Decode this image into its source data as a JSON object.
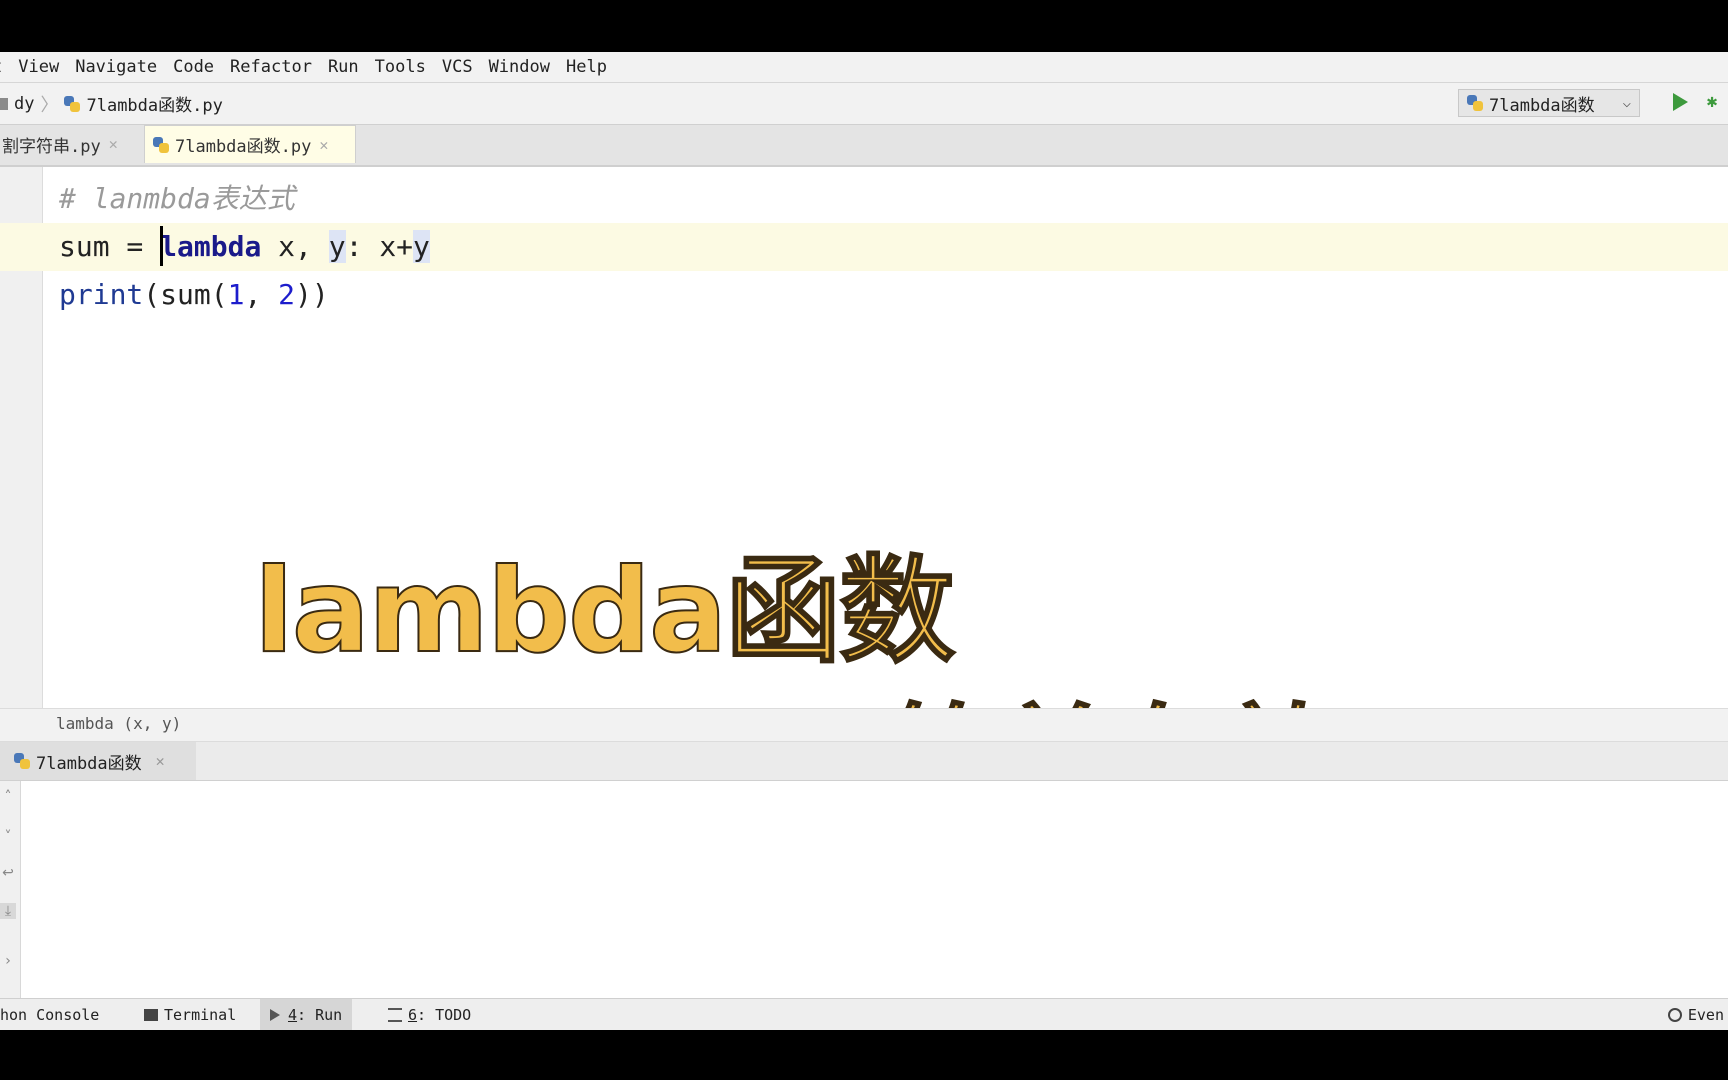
{
  "menu": [
    "t",
    "View",
    "Navigate",
    "Code",
    "Refactor",
    "Run",
    "Tools",
    "VCS",
    "Window",
    "Help"
  ],
  "breadcrumb": {
    "folder": "dy",
    "file": "7lambda函数.py"
  },
  "run_config": {
    "label": "7lambda函数"
  },
  "tabs": [
    {
      "label": "割字符串.py"
    },
    {
      "label": "7lambda函数.py"
    }
  ],
  "code": {
    "line1_comment": "# lanmbda表达式",
    "line2_sum": "sum",
    "line2_eq": " = ",
    "line2_lambda": "lambda",
    "line2_x": " x, ",
    "line2_y": "y",
    "line2_colon": ": x+",
    "line2_y2": "y",
    "line3_print": "print",
    "line3_open": "(sum(",
    "line3_n1": "1",
    "line3_comma": ", ",
    "line3_n2": "2",
    "line3_close": "))"
  },
  "overlay": {
    "title": "lambda函数",
    "subtitle": "简单有效"
  },
  "hint": "lambda (x, y)",
  "run_panel": {
    "tab_label": "7lambda函数"
  },
  "statusbar": {
    "python_console": "hon Console",
    "terminal": "Terminal",
    "run_num": "4",
    "run_label": ": Run",
    "todo_num": "6",
    "todo_label": ": TODO",
    "event": "Even"
  },
  "colors": {
    "overlay_text": "#f2bd4b",
    "run_green": "#3d9a3d",
    "active_line": "#fcfae3"
  }
}
